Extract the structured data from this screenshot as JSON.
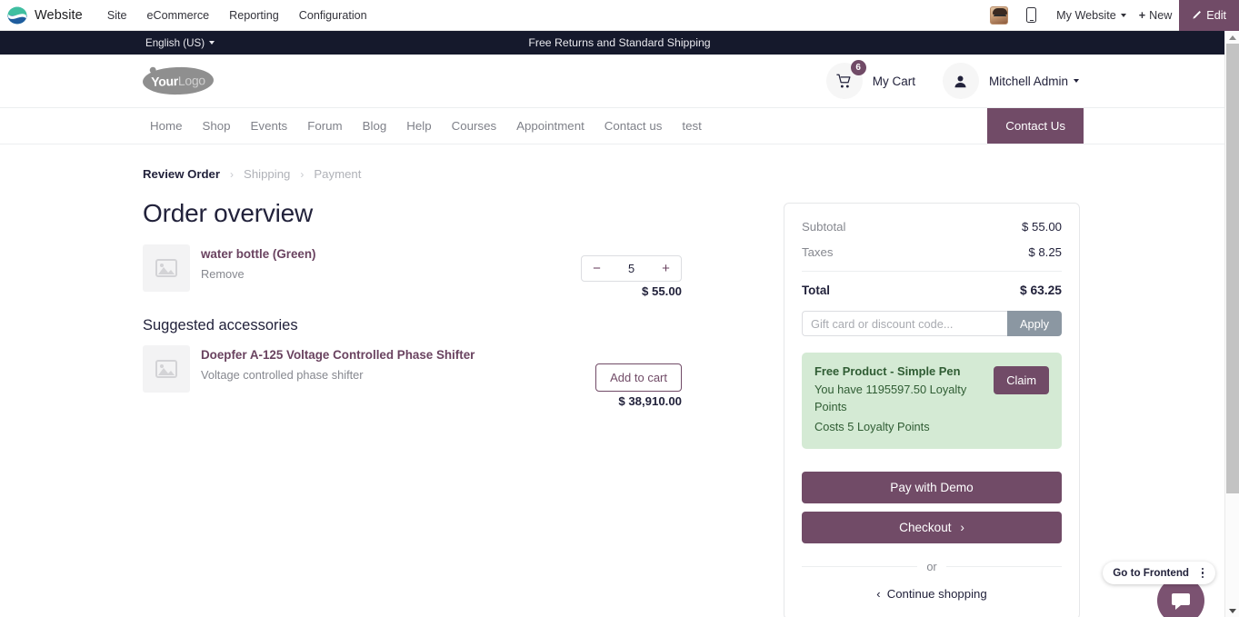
{
  "backend": {
    "brand": "Website",
    "menu": [
      "Site",
      "eCommerce",
      "Reporting",
      "Configuration"
    ],
    "website_selector": "My Website",
    "new_label": "New",
    "new_plus": "+",
    "edit_label": "Edit",
    "edit_icon": "pencil-icon",
    "mobile_icon": "mobile-preview-icon",
    "avatar": "user-avatar"
  },
  "promo_strip": {
    "text": "Free Returns and Standard Shipping",
    "language": "English (US)"
  },
  "site_header": {
    "logo_part1": "Your",
    "logo_part2": "Logo",
    "cart_label": "My Cart",
    "cart_count": "6",
    "cart_icon": "shopping-cart-icon",
    "user_icon": "user-icon",
    "user_name": "Mitchell Admin"
  },
  "site_nav": {
    "links": [
      "Home",
      "Shop",
      "Events",
      "Forum",
      "Blog",
      "Help",
      "Courses",
      "Appointment",
      "Contact us",
      "test"
    ],
    "cta": "Contact Us"
  },
  "breadcrumb": {
    "step1": "Review Order",
    "step2": "Shipping",
    "step3": "Payment",
    "separator": "›"
  },
  "main": {
    "title": "Order overview",
    "cart_items": [
      {
        "name": "water bottle (Green)",
        "remove_label": "Remove",
        "qty": "5",
        "minus": "−",
        "plus": "+",
        "price": "$ 55.00",
        "thumb_icon": "image-placeholder-icon"
      }
    ],
    "suggested_title": "Suggested accessories",
    "suggested": [
      {
        "name": "Doepfer A-125 Voltage Controlled Phase Shifter",
        "description": "Voltage controlled phase shifter",
        "button": "Add to cart",
        "price": "$ 38,910.00",
        "thumb_icon": "image-placeholder-icon"
      }
    ]
  },
  "summary": {
    "subtotal_label": "Subtotal",
    "subtotal_value": "$ 55.00",
    "taxes_label": "Taxes",
    "taxes_value": "$ 8.25",
    "total_label": "Total",
    "total_value": "$ 63.25",
    "coupon_placeholder": "Gift card or discount code...",
    "coupon_value": "",
    "apply_label": "Apply",
    "reward": {
      "title": "Free Product - Simple Pen",
      "line1": "You have 1195597.50 Loyalty Points",
      "line2": "Costs 5 Loyalty Points",
      "claim_label": "Claim"
    },
    "pay_label": "Pay with Demo",
    "checkout_label": "Checkout",
    "checkout_chevron": "›",
    "or_label": "or",
    "continue_label": "Continue shopping",
    "continue_chevron": "‹"
  },
  "widget": {
    "frontend_label": "Go to Frontend",
    "kebab_icon": "more-options-icon",
    "chat_icon": "chat-bubble-icon"
  },
  "colors": {
    "brand_purple": "#714b67",
    "dark_navy": "#15192c",
    "promo_green_bg": "#d4ead4",
    "promo_green_text": "#2f5c33",
    "apply_gray": "#8b97a2"
  }
}
